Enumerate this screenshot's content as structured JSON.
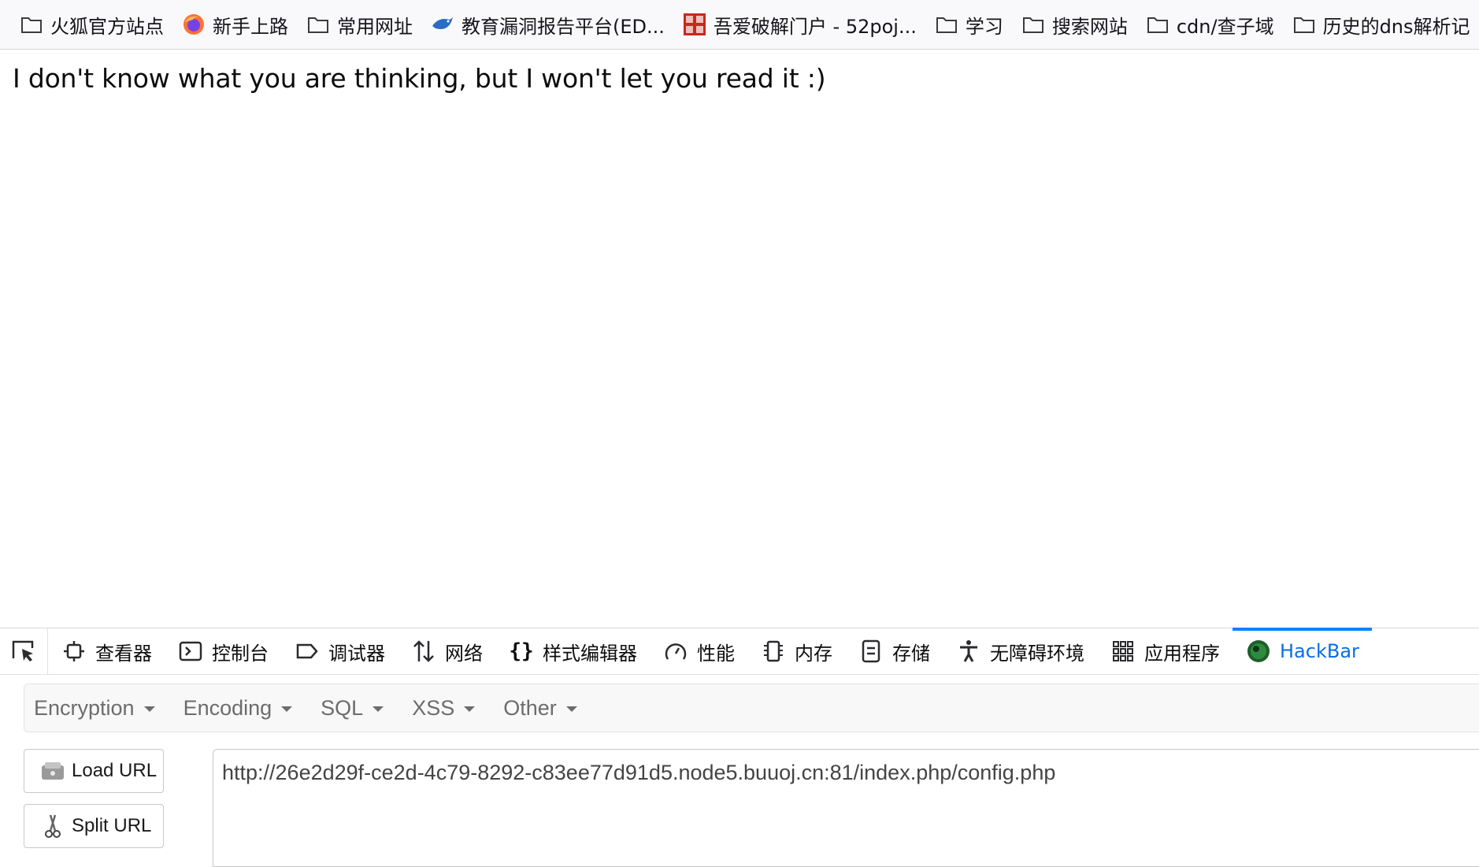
{
  "bookmarks": [
    {
      "label": "火狐官方站点",
      "icon": "folder-icon"
    },
    {
      "label": "新手上路",
      "icon": "firefox-icon"
    },
    {
      "label": "常用网址",
      "icon": "folder-icon"
    },
    {
      "label": "教育漏洞报告平台(ED...",
      "icon": "bird-icon"
    },
    {
      "label": "吾爱破解门户 - 52poj...",
      "icon": "52pojie-icon"
    },
    {
      "label": "学习",
      "icon": "folder-icon"
    },
    {
      "label": "搜索网站",
      "icon": "folder-icon"
    },
    {
      "label": "cdn/查子域",
      "icon": "folder-icon"
    },
    {
      "label": "历史的dns解析记",
      "icon": "folder-icon"
    }
  ],
  "page": {
    "message": "I don't know what you are thinking, but I won't let you read it :)"
  },
  "devtools": {
    "tabs": [
      {
        "label": "查看器",
        "icon": "inspector-icon"
      },
      {
        "label": "控制台",
        "icon": "console-icon"
      },
      {
        "label": "调试器",
        "icon": "debugger-icon"
      },
      {
        "label": "网络",
        "icon": "network-icon"
      },
      {
        "label": "样式编辑器",
        "icon": "style-editor-icon"
      },
      {
        "label": "性能",
        "icon": "performance-icon"
      },
      {
        "label": "内存",
        "icon": "memory-icon"
      },
      {
        "label": "存储",
        "icon": "storage-icon"
      },
      {
        "label": "无障碍环境",
        "icon": "accessibility-icon"
      },
      {
        "label": "应用程序",
        "icon": "application-icon"
      },
      {
        "label": "HackBar",
        "icon": "hackbar-icon",
        "active": true
      }
    ],
    "accent_color": "#0a84ff"
  },
  "hackbar": {
    "menu": [
      "Encryption",
      "Encoding",
      "SQL",
      "XSS",
      "Other"
    ],
    "load_url_label": "Load URL",
    "split_url_label": "Split URL",
    "url_value": "http://26e2d29f-ce2d-4c79-8292-c83ee77d91d5.node5.buuoj.cn:81/index.php/config.php"
  }
}
